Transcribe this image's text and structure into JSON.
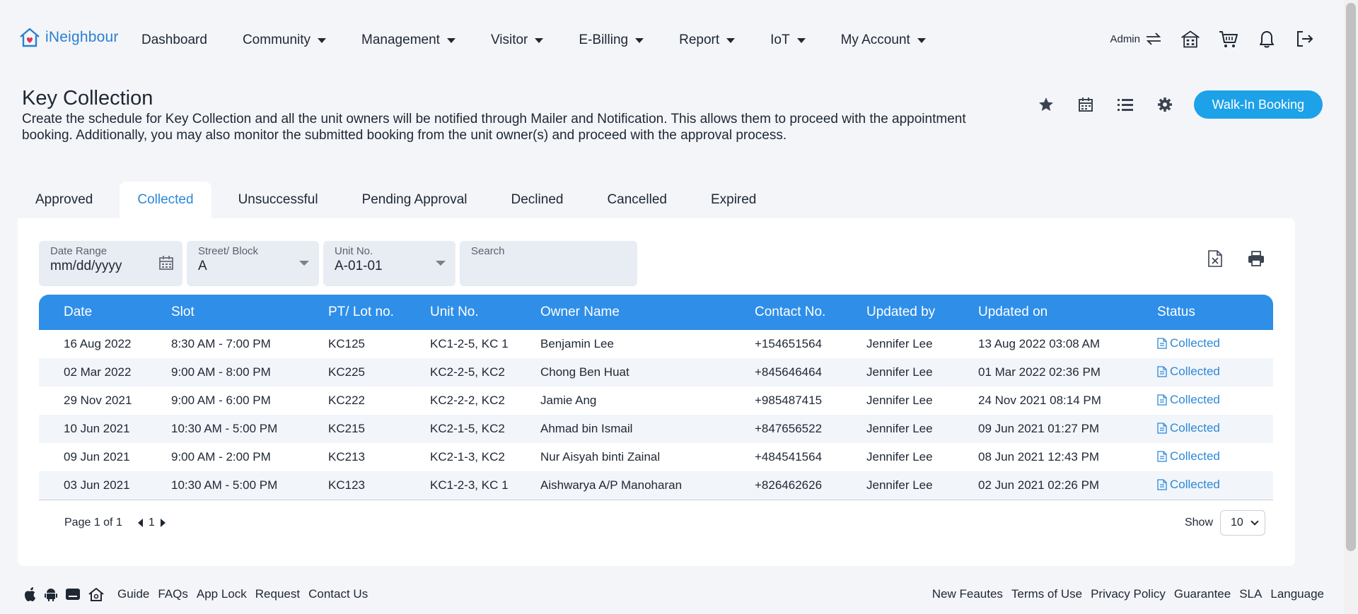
{
  "app": {
    "name": "iNeighbour"
  },
  "nav": {
    "items": [
      {
        "label": "Dashboard",
        "dropdown": false
      },
      {
        "label": "Community",
        "dropdown": true
      },
      {
        "label": "Management",
        "dropdown": true
      },
      {
        "label": "Visitor",
        "dropdown": true
      },
      {
        "label": "E-Billing",
        "dropdown": true
      },
      {
        "label": "Report",
        "dropdown": true
      },
      {
        "label": "IoT",
        "dropdown": true
      },
      {
        "label": "My Account",
        "dropdown": true
      }
    ],
    "admin_label": "Admin",
    "icons": [
      "switch-icon",
      "building-icon",
      "cart-icon",
      "bell-icon",
      "logout-icon"
    ]
  },
  "header": {
    "title": "Key Collection",
    "description": "Create the schedule for Key Collection and all the unit owners will be notified through Mailer and Notification. This allows them to proceed with the appointment booking. Additionally, you may also monitor the submitted booking from the unit owner(s) and proceed with the approval process.",
    "walkin_label": "Walk-In Booking",
    "accent": "#1da1e8"
  },
  "tabs": [
    {
      "label": "Approved",
      "active": false
    },
    {
      "label": "Collected",
      "active": true
    },
    {
      "label": "Unsuccessful",
      "active": false
    },
    {
      "label": "Pending Approval",
      "active": false
    },
    {
      "label": "Declined",
      "active": false
    },
    {
      "label": "Cancelled",
      "active": false
    },
    {
      "label": "Expired",
      "active": false
    }
  ],
  "filters": {
    "date": {
      "label": "Date Range",
      "value": "mm/dd/yyyy"
    },
    "street": {
      "label": "Street/ Block",
      "value": "A"
    },
    "unit": {
      "label": "Unit No.",
      "value": "A-01-01"
    },
    "search": {
      "label": "Search",
      "value": ""
    }
  },
  "table": {
    "headers": [
      "Date",
      "Slot",
      "PT/ Lot no.",
      "Unit No.",
      "Owner Name",
      "Contact No.",
      "Updated by",
      "Updated on",
      "Status"
    ],
    "rows": [
      [
        "16 Aug 2022",
        "8:30 AM - 7:00 PM",
        "KC125",
        "KC1-2-5, KC 1",
        "Benjamin Lee",
        "+154651564",
        "Jennifer Lee",
        "13 Aug 2022 03:08 AM",
        "Collected"
      ],
      [
        "02 Mar 2022",
        "9:00 AM - 8:00 PM",
        "KC225",
        "KC2-2-5, KC2",
        "Chong Ben Huat",
        "+845646464",
        "Jennifer Lee",
        "01 Mar 2022 02:36 PM",
        "Collected"
      ],
      [
        "29 Nov 2021",
        "9:00 AM - 6:00 PM",
        "KC222",
        "KC2-2-2, KC2",
        "Jamie Ang",
        "+985487415",
        "Jennifer Lee",
        "24 Nov 2021 08:14 PM",
        "Collected"
      ],
      [
        "10 Jun 2021",
        "10:30 AM - 5:00 PM",
        "KC215",
        "KC2-1-5, KC2",
        "Ahmad bin Ismail",
        "+847656522",
        "Jennifer Lee",
        "09 Jun 2021 01:27 PM",
        "Collected"
      ],
      [
        "09 Jun 2021",
        "9:00 AM - 2:00 PM",
        "KC213",
        "KC2-1-3, KC2",
        "Nur Aisyah binti Zainal",
        "+484541564",
        "Jennifer Lee",
        "08 Jun 2021 12:43 PM",
        "Collected"
      ],
      [
        "03 Jun 2021",
        "10:30 AM - 5:00 PM",
        "KC123",
        "KC1-2-3, KC 1",
        "Aishwarya A/P Manoharan",
        "+826462626",
        "Jennifer Lee",
        "02 Jun 2021 02:26 PM",
        "Collected"
      ]
    ],
    "header_color": "#2e8ee8"
  },
  "pagination": {
    "page_text": "Page 1 of 1",
    "current_page": "1",
    "show_label": "Show",
    "show_value": "10"
  },
  "footer": {
    "links_left": [
      "Guide",
      "FAQs",
      "App Lock",
      "Request",
      "Contact Us"
    ],
    "links_right": [
      "New Feautes",
      "Terms of Use",
      "Privacy Policy",
      "Guarantee",
      "SLA",
      "Language"
    ],
    "icons": [
      "apple-icon",
      "android-icon",
      "tablet-icon",
      "home-icon"
    ]
  }
}
